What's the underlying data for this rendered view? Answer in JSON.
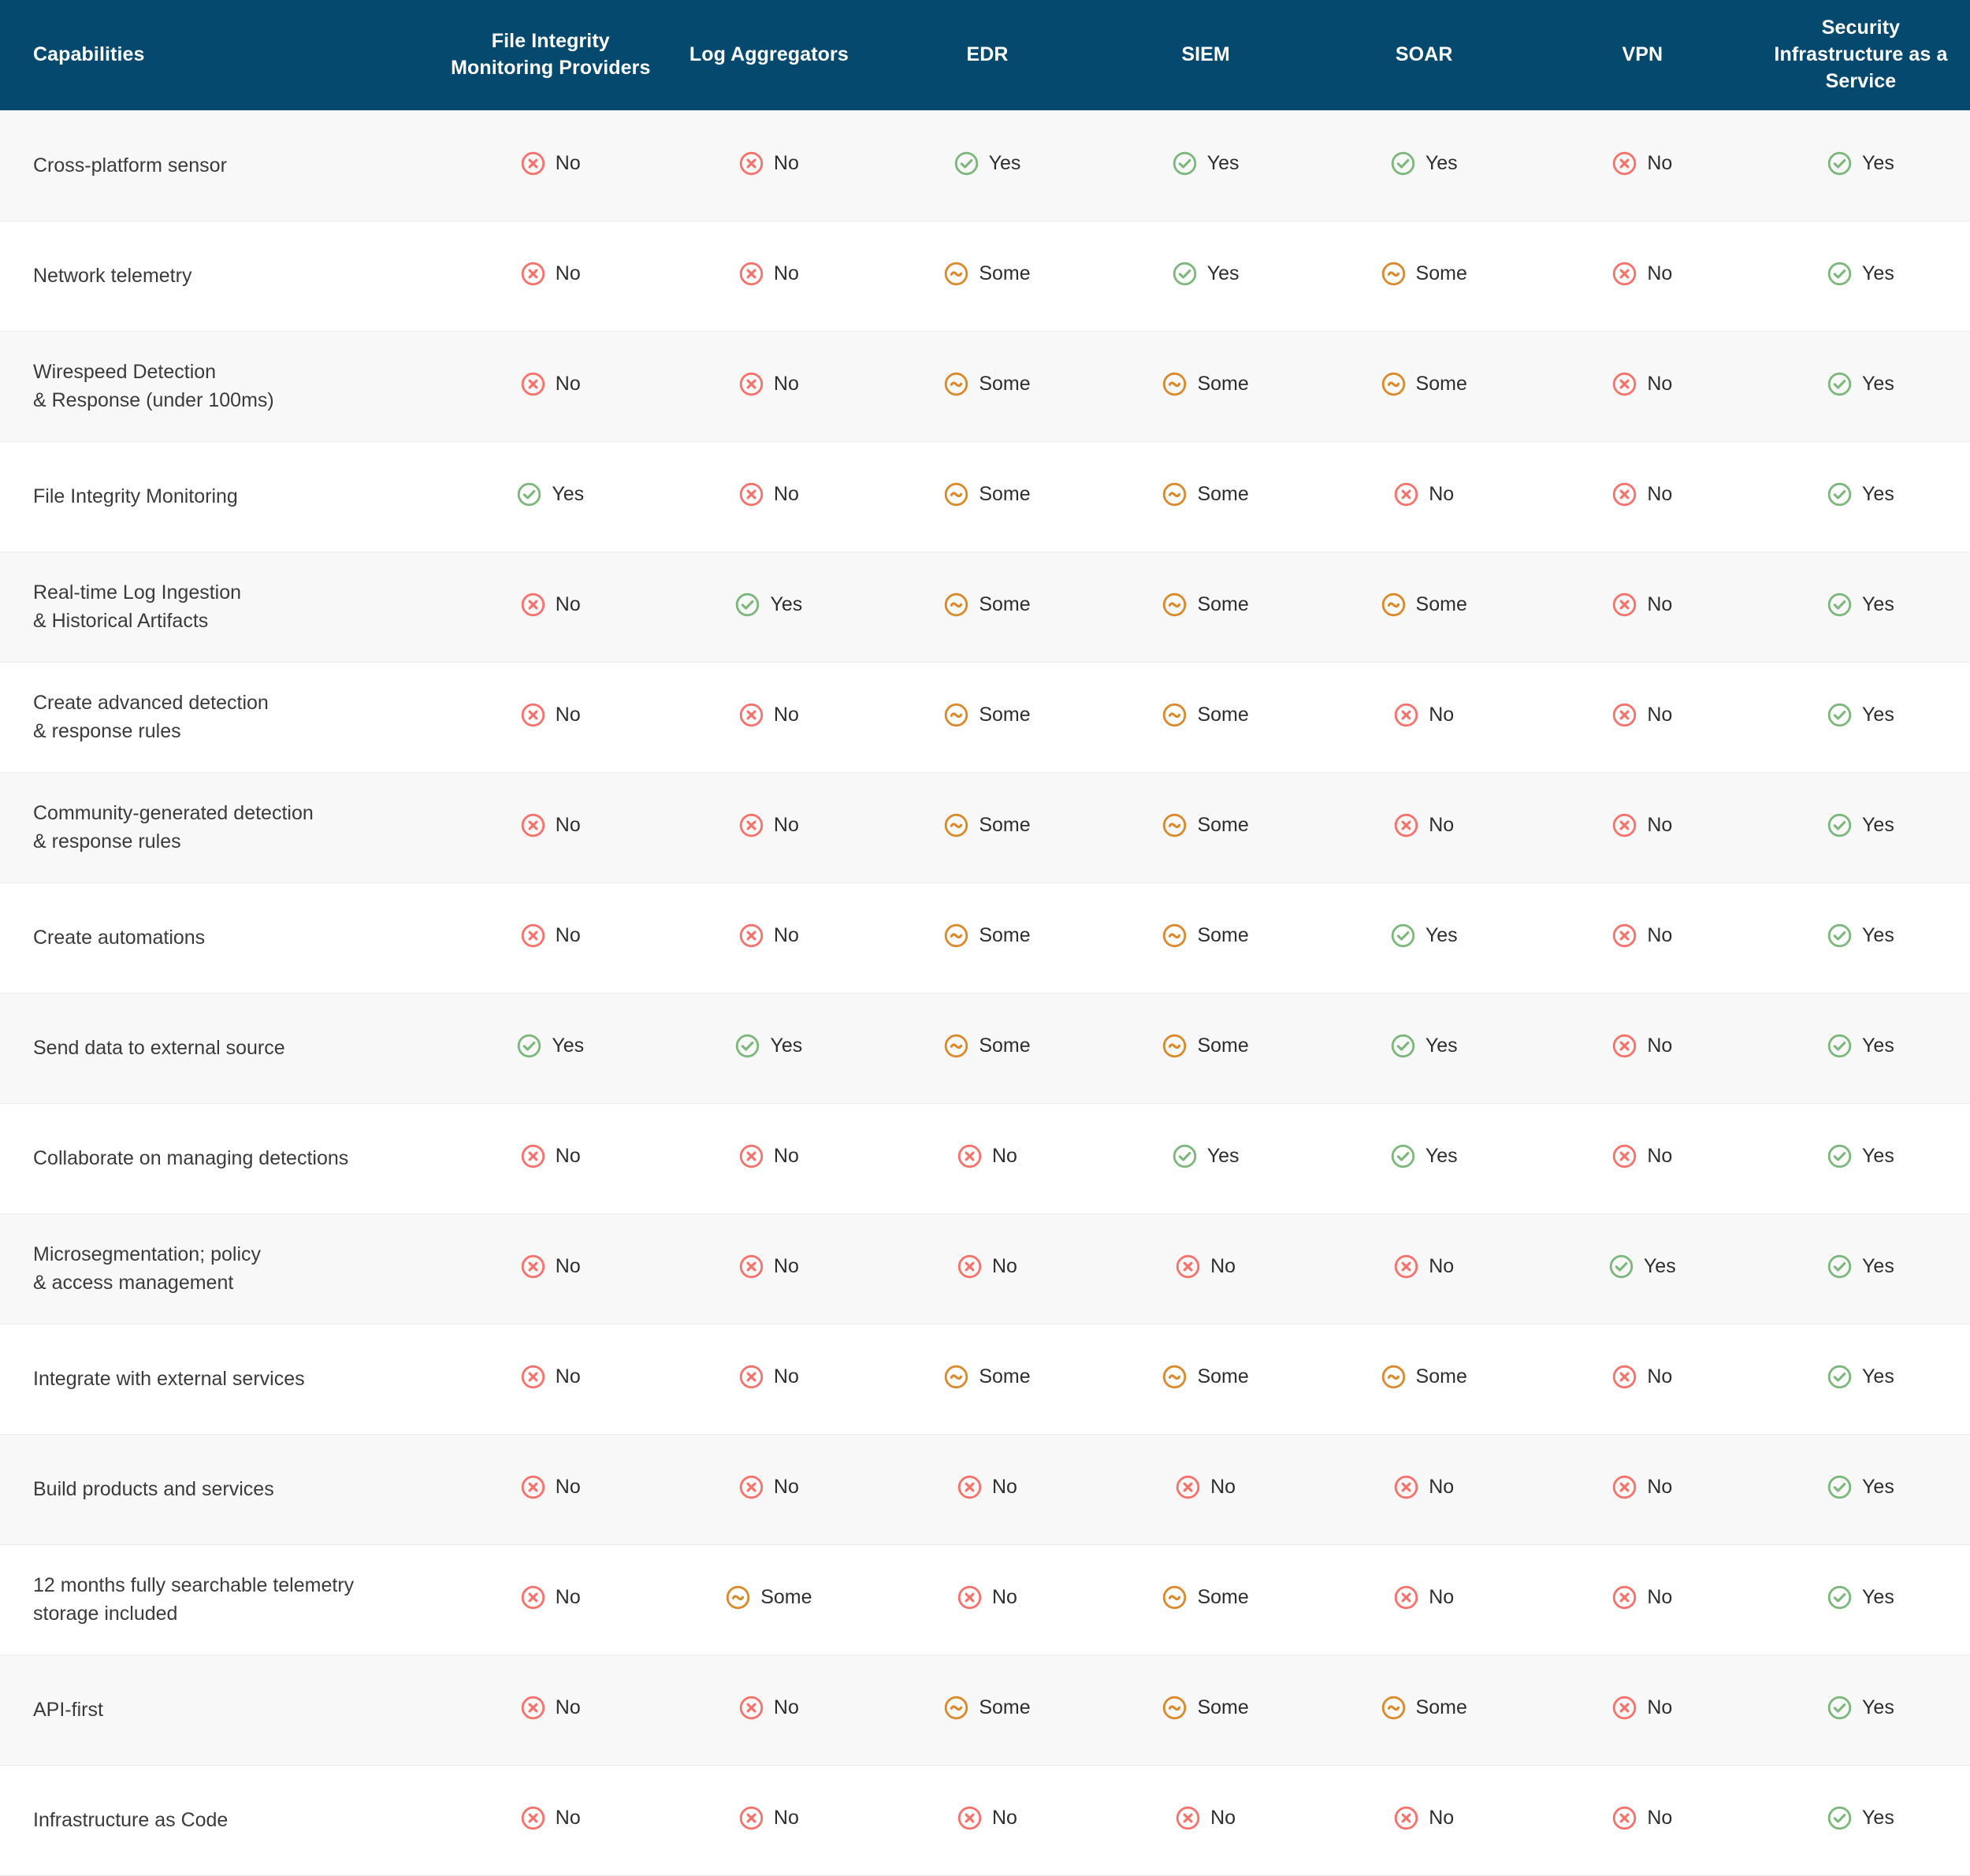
{
  "table": {
    "columns": [
      {
        "key": "capabilities",
        "label": "Capabilities"
      },
      {
        "key": "fim",
        "label": "File Integrity Monitoring Providers"
      },
      {
        "key": "logagg",
        "label": "Log Aggregators"
      },
      {
        "key": "edr",
        "label": "EDR"
      },
      {
        "key": "siem",
        "label": "SIEM"
      },
      {
        "key": "soar",
        "label": "SOAR"
      },
      {
        "key": "vpn",
        "label": "VPN"
      },
      {
        "key": "siaas",
        "label": "Security Infrastructure as a Service"
      }
    ],
    "status_labels": {
      "yes": "Yes",
      "no": "No",
      "some": "Some"
    },
    "colors": {
      "header_background": "#054A6E",
      "header_text": "#FFFFFF",
      "row_stripe": "#F8F8F8",
      "row_base": "#FFFFFF",
      "row_divider": "#ECECEC",
      "body_text": "#3B3B3B",
      "yes": "#7CB77C",
      "no": "#F8726B",
      "some": "#DB8A2B"
    },
    "rows": [
      {
        "capability": "Cross-platform sensor",
        "values": [
          "no",
          "no",
          "yes",
          "yes",
          "yes",
          "no",
          "yes"
        ]
      },
      {
        "capability": "Network telemetry",
        "values": [
          "no",
          "no",
          "some",
          "yes",
          "some",
          "no",
          "yes"
        ]
      },
      {
        "capability": "Wirespeed Detection\n& Response (under 100ms)",
        "values": [
          "no",
          "no",
          "some",
          "some",
          "some",
          "no",
          "yes"
        ]
      },
      {
        "capability": "File Integrity Monitoring",
        "values": [
          "yes",
          "no",
          "some",
          "some",
          "no",
          "no",
          "yes"
        ]
      },
      {
        "capability": "Real-time Log Ingestion\n& Historical Artifacts",
        "values": [
          "no",
          "yes",
          "some",
          "some",
          "some",
          "no",
          "yes"
        ]
      },
      {
        "capability": "Create advanced detection\n& response rules",
        "values": [
          "no",
          "no",
          "some",
          "some",
          "no",
          "no",
          "yes"
        ]
      },
      {
        "capability": "Community-generated detection\n& response rules",
        "values": [
          "no",
          "no",
          "some",
          "some",
          "no",
          "no",
          "yes"
        ]
      },
      {
        "capability": "Create automations",
        "values": [
          "no",
          "no",
          "some",
          "some",
          "yes",
          "no",
          "yes"
        ]
      },
      {
        "capability": "Send data to external source",
        "values": [
          "yes",
          "yes",
          "some",
          "some",
          "yes",
          "no",
          "yes"
        ]
      },
      {
        "capability": "Collaborate on managing detections",
        "values": [
          "no",
          "no",
          "no",
          "yes",
          "yes",
          "no",
          "yes"
        ]
      },
      {
        "capability": "Microsegmentation; policy\n& access management",
        "values": [
          "no",
          "no",
          "no",
          "no",
          "no",
          "yes",
          "yes"
        ]
      },
      {
        "capability": "Integrate with external services",
        "values": [
          "no",
          "no",
          "some",
          "some",
          "some",
          "no",
          "yes"
        ]
      },
      {
        "capability": "Build products and services",
        "values": [
          "no",
          "no",
          "no",
          "no",
          "no",
          "no",
          "yes"
        ]
      },
      {
        "capability": "12 months fully searchable telemetry\nstorage included",
        "values": [
          "no",
          "some",
          "no",
          "some",
          "no",
          "no",
          "yes"
        ]
      },
      {
        "capability": "API-first",
        "values": [
          "no",
          "no",
          "some",
          "some",
          "some",
          "no",
          "yes"
        ]
      },
      {
        "capability": "Infrastructure as Code",
        "values": [
          "no",
          "no",
          "no",
          "no",
          "no",
          "no",
          "yes"
        ]
      }
    ]
  }
}
